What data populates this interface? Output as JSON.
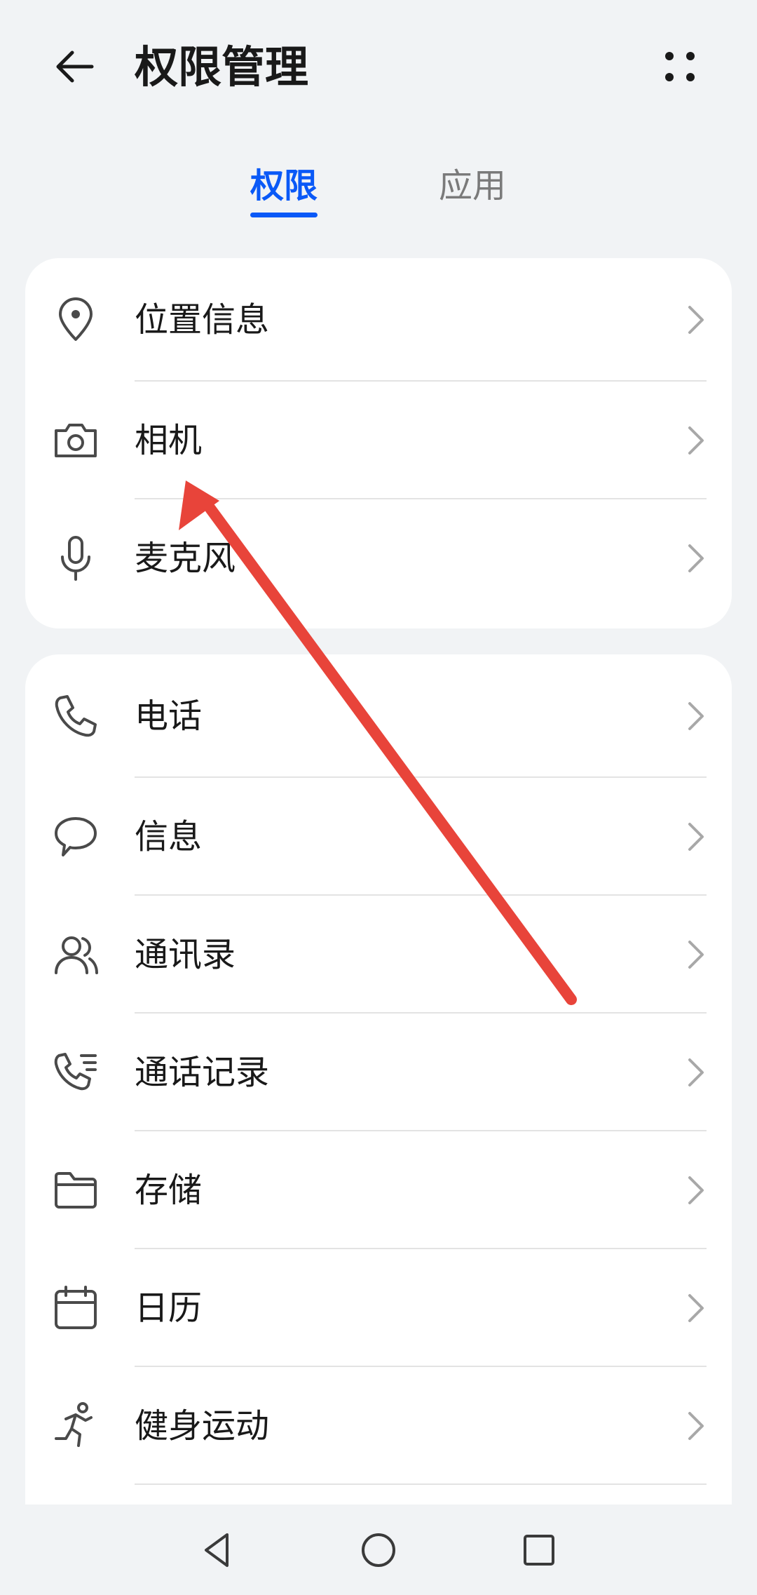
{
  "header": {
    "title": "权限管理",
    "back_icon": "arrow-left-icon",
    "more_icon": "more-dots-icon"
  },
  "tabs": [
    {
      "label": "权限",
      "active": true
    },
    {
      "label": "应用",
      "active": false
    }
  ],
  "colors": {
    "accent": "#0a59f7",
    "background": "#f1f3f5",
    "card": "#ffffff",
    "annotation_arrow": "#e8443a"
  },
  "groups": [
    {
      "items": [
        {
          "label": "位置信息",
          "icon": "location-pin-icon"
        },
        {
          "label": "相机",
          "icon": "camera-icon"
        },
        {
          "label": "麦克风",
          "icon": "microphone-icon"
        }
      ]
    },
    {
      "items": [
        {
          "label": "电话",
          "icon": "phone-icon"
        },
        {
          "label": "信息",
          "icon": "message-bubble-icon"
        },
        {
          "label": "通讯录",
          "icon": "contacts-icon"
        },
        {
          "label": "通话记录",
          "icon": "call-log-icon"
        },
        {
          "label": "存储",
          "icon": "folder-icon"
        },
        {
          "label": "日历",
          "icon": "calendar-icon"
        },
        {
          "label": "健身运动",
          "icon": "running-icon"
        }
      ]
    }
  ],
  "navbar": {
    "back_icon": "nav-back-triangle-icon",
    "home_icon": "nav-home-circle-icon",
    "recent_icon": "nav-recent-square-icon"
  }
}
